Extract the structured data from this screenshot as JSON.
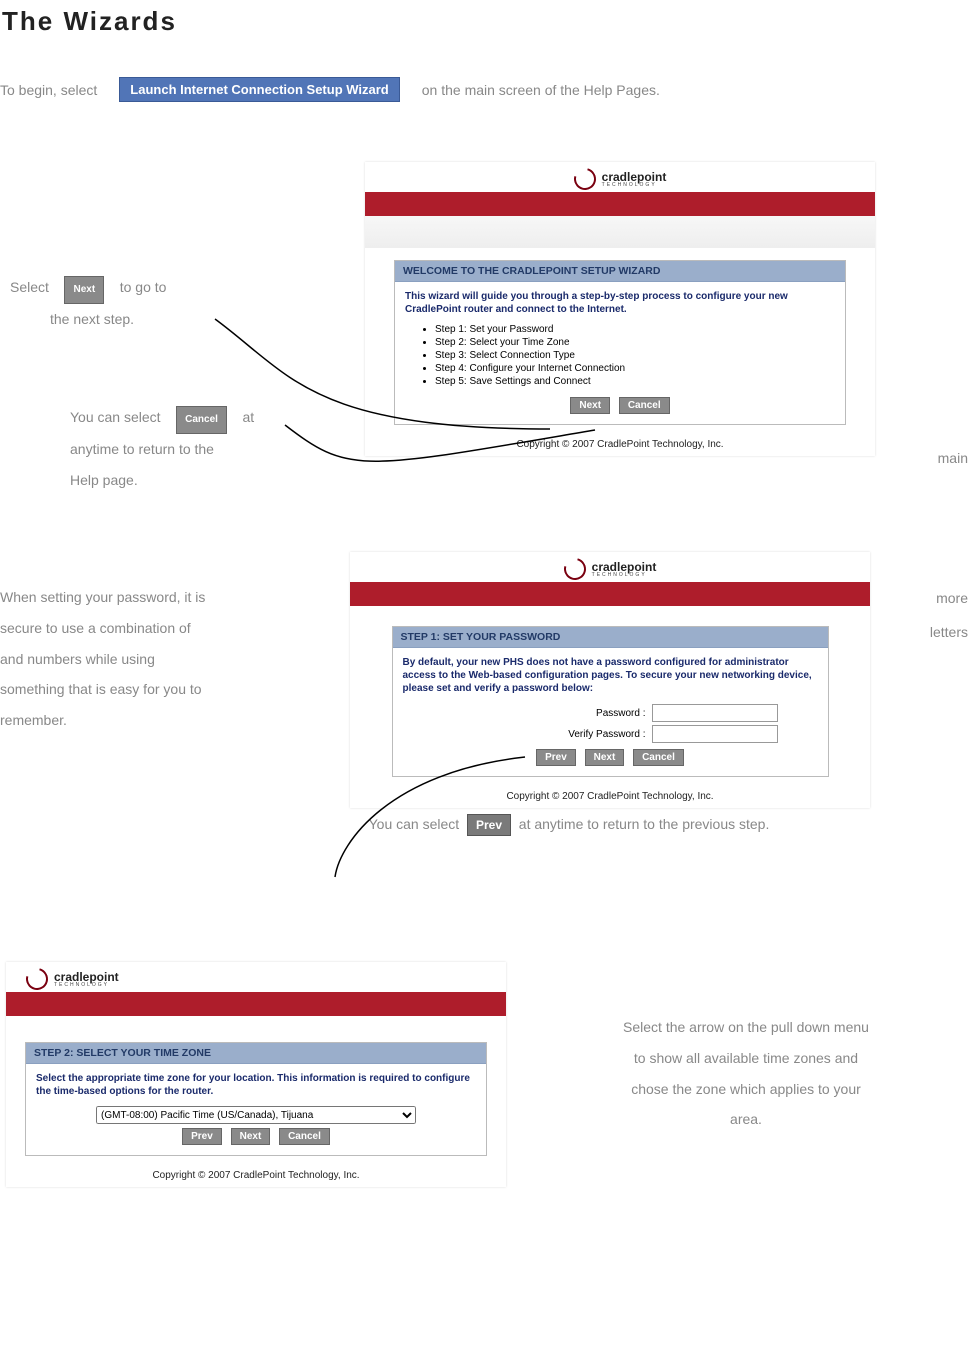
{
  "page_title": "The Wizards",
  "intro_before": "To begin, select",
  "launch_button": "Launch Internet Connection Setup Wizard",
  "intro_after": "on the main screen of the Help Pages.",
  "note_next_before": "Select",
  "btn_next": "Next",
  "note_next_after": "to go to",
  "note_next_line2": "the next step.",
  "note_cancel_before": "You can select",
  "btn_cancel": "Cancel",
  "note_cancel_after": "at",
  "note_cancel_line2": "anytime to return to the",
  "note_cancel_line3": "Help page.",
  "word_main": "main",
  "logo_brand": "cradlepoint",
  "logo_sub": "TECHNOLOGY",
  "wizard1": {
    "title": "WELCOME TO THE CRADLEPOINT SETUP WIZARD",
    "desc": "This wizard will guide you through a step-by-step process to configure your new CradlePoint router and connect to the Internet.",
    "steps": [
      "Step 1: Set your Password",
      "Step 2: Select your Time Zone",
      "Step 3: Select Connection Type",
      "Step 4: Configure your Internet Connection",
      "Step 5: Save Settings and Connect"
    ],
    "btn_next": "Next",
    "btn_cancel": "Cancel"
  },
  "copyright": "Copyright © 2007 CradlePoint Technology, Inc.",
  "password_note_line1": "When setting your password, it is",
  "password_note_line2": "secure to use a combination of",
  "password_note_line3": "and numbers while using",
  "password_note_line4": "something that is easy for you to",
  "password_note_line5": "remember.",
  "word_more": "more",
  "word_letters": "letters",
  "wizard2": {
    "title": "STEP 1: SET YOUR PASSWORD",
    "desc": "By default, your new PHS does not have a password configured for administrator access to the Web-based configuration pages. To secure your new networking device, please set and verify a password below:",
    "label_password": "Password :",
    "label_verify": "Verify Password :",
    "btn_prev": "Prev",
    "btn_next": "Next",
    "btn_cancel": "Cancel"
  },
  "prev_note_before": "You can select",
  "btn_prev_big": "Prev",
  "prev_note_after": "at anytime to return to the previous step.",
  "wizard3": {
    "title": "STEP 2: SELECT YOUR TIME ZONE",
    "desc": "Select the appropriate time zone for your location. This information is required to configure the time-based options for the router.",
    "tz_value": "(GMT-08:00) Pacific Time (US/Canada), Tijuana",
    "btn_prev": "Prev",
    "btn_next": "Next",
    "btn_cancel": "Cancel"
  },
  "tz_note_line1": "Select the arrow on the pull down menu",
  "tz_note_line2": "to show all available    time zones and",
  "tz_note_line3": "chose the zone which applies to your",
  "tz_note_line4": "area."
}
